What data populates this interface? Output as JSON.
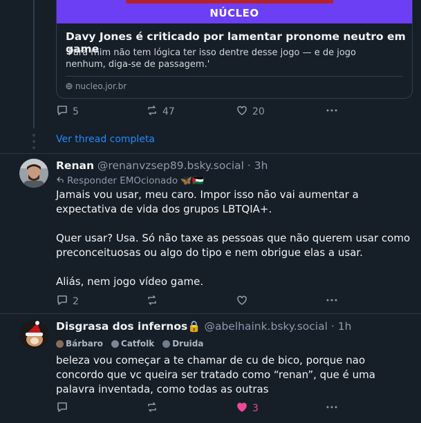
{
  "link_card": {
    "brand": "NÚCLEO",
    "title": "Davy Jones é criticado por lamentar pronome neutro em game",
    "description": "'Para mim não tem lógica ter isso dentre desse jogo — e de jogo nenhum, diga-se de passagem.'",
    "domain": "nucleo.jor.br"
  },
  "parent_actions": {
    "replies": "5",
    "reposts": "47",
    "likes": "20"
  },
  "see_thread": "Ver thread completa",
  "posts": [
    {
      "author": "Renan",
      "handle": "@renanvzsep89.bsky.social",
      "time": "· 3h",
      "replying_to": "Responder EMOcionado 🦋🇵🇸",
      "paragraphs": [
        "Jamais vou usar, meu caro.  Impor isso não vai aumentar a expectativa de vida dos grupos LBTQIA+.",
        "Quer usar? Usa. Só não taxe as pessoas que não querem usar como preconceituosas ou algo do tipo e nem obrigue elas a usar.",
        "Aliás, nem jogo vídeo game."
      ],
      "replies": "2"
    },
    {
      "author": "Disgrasa dos infernos🔒",
      "handle": "@abelhaink.bsky.social",
      "time": "· 1h",
      "badges": [
        "Bárbaro",
        "Catfolk",
        "Druida"
      ],
      "text": "beleza vou começar a te chamar de cu de bico, porque nao concordo que vc queira ser tratado como “renan”, que é uma palavra inventada, como todas as outras",
      "likes": "3"
    }
  ],
  "colors": {
    "background": "#161e27",
    "link": "#208bfe",
    "muted": "#8d9bac",
    "like": "#ec4899",
    "banner": "#6c3ff5"
  },
  "icons": [
    "reply-icon",
    "repost-icon",
    "heart-icon",
    "more-icon",
    "reply-arrow-icon",
    "globe-icon"
  ]
}
